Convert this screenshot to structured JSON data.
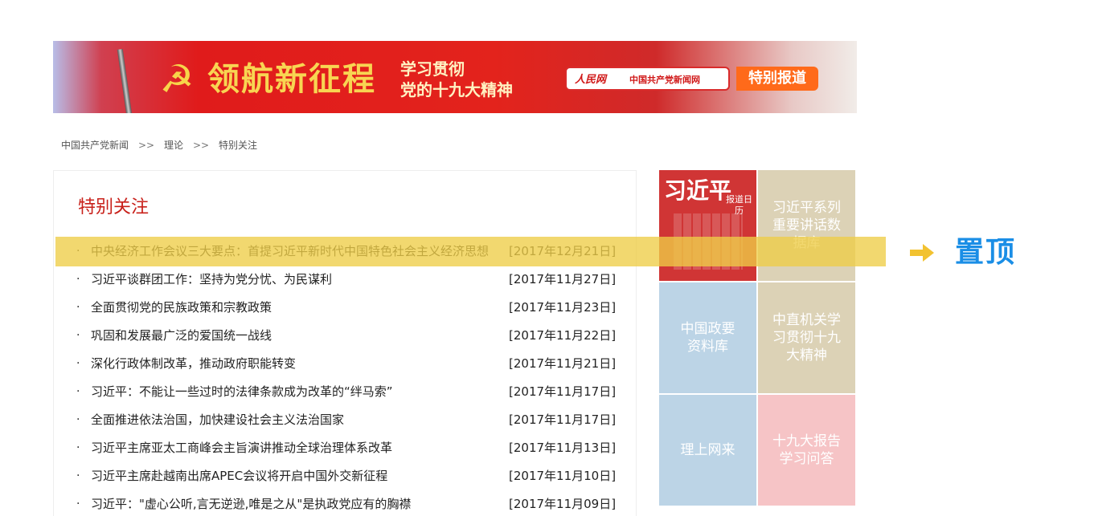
{
  "banner": {
    "title": "领航新征程",
    "subtitle_line1": "学习贯彻",
    "subtitle_line2": "党的十九大精神",
    "logo_people": "人民网",
    "logo_people_url": "people.cn",
    "logo_cpc": "中国共产党新闻网",
    "logo_cpc_url": "www.cpcnews.cn",
    "special_label": "特别报道",
    "emblem": "☭",
    "colors": {
      "red": "#e3231c",
      "gold": "#f8d552",
      "orange": "#ff6a1a"
    }
  },
  "breadcrumb": {
    "items": [
      "中国共产党新闻",
      "理论",
      "特别关注"
    ],
    "separator": ">>"
  },
  "main": {
    "section_title": "特别关注",
    "bullet": "·",
    "news": [
      {
        "headline": "中央经济工作会议三大要点：首提习近平新时代中国特色社会主义经济思想",
        "date": "[2017年12月21日]"
      },
      {
        "headline": "习近平谈群团工作：坚持为党分忧、为民谋利",
        "date": "[2017年11月27日]"
      },
      {
        "headline": "全面贯彻党的民族政策和宗教政策",
        "date": "[2017年11月23日]"
      },
      {
        "headline": "巩固和发展最广泛的爱国统一战线",
        "date": "[2017年11月22日]"
      },
      {
        "headline": "深化行政体制改革，推动政府职能转变",
        "date": "[2017年11月21日]"
      },
      {
        "headline": "习近平：不能让一些过时的法律条款成为改革的“绊马索”",
        "date": "[2017年11月17日]"
      },
      {
        "headline": "全面推进依法治国，加快建设社会主义法治国家",
        "date": "[2017年11月17日]"
      },
      {
        "headline": "习近平主席亚太工商峰会主旨演讲推动全球治理体系改革",
        "date": "[2017年11月13日]"
      },
      {
        "headline": "习近平主席赴越南出席APEC会议将开启中国外交新征程",
        "date": "[2017年11月10日]"
      },
      {
        "headline": "习近平：\"虚心公听,言无逆逊,唯是之从\"是执政党应有的胸襟",
        "date": "[2017年11月09日]"
      }
    ]
  },
  "tiles": {
    "calendar": {
      "title": "习近平",
      "subtitle": "报道日历"
    },
    "speech_db": "习近平系列重要讲话数据库",
    "gov_docs": "中国政要资料库",
    "organs": "中直机关学习贯彻十九大精神",
    "theory": "理上网来",
    "report_qa": "十九大报告学习问答",
    "colors": {
      "red": "#d03535",
      "beige": "#dcd2b6",
      "blue": "#bcd4e6",
      "pink": "#f6c4c6"
    }
  },
  "pin": {
    "label": "置顶",
    "arrow_icon": "arrow-right-icon",
    "highlight_color": "#eecd46",
    "label_color": "#1a8ee6"
  }
}
